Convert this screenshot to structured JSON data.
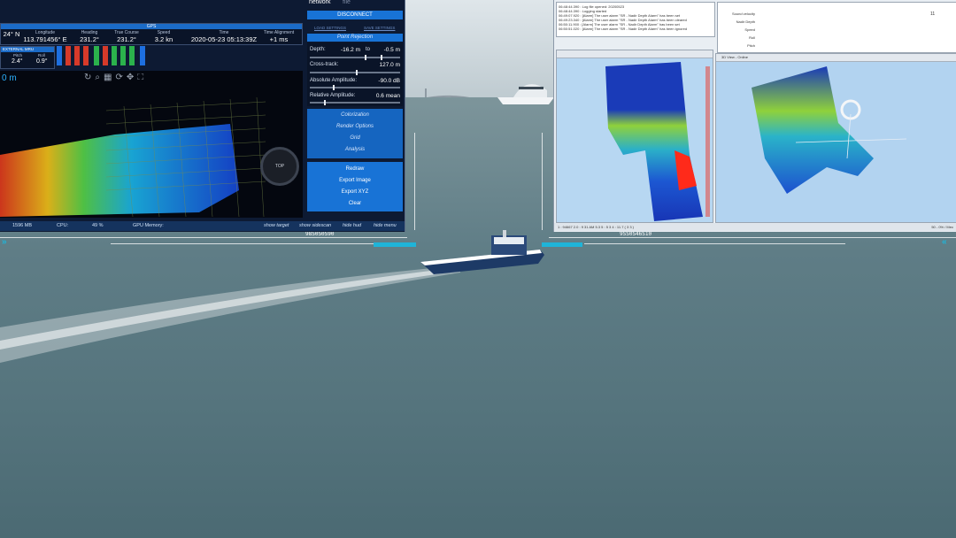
{
  "gps": {
    "title": "GPS",
    "fields": [
      {
        "label": "",
        "value": "24° N"
      },
      {
        "label": "Longitude",
        "value": "113.791456° E"
      },
      {
        "label": "Heading",
        "value": "231.2°"
      },
      {
        "label": "True Course",
        "value": "231.2°"
      },
      {
        "label": "Speed",
        "value": "3.2 kn"
      },
      {
        "label": "Time",
        "value": "2020-05-23 05:13:39Z"
      },
      {
        "label": "Time Alignment",
        "value": "+1 ms"
      }
    ]
  },
  "external_mru": {
    "title": "EXTERNAL MRU",
    "fields": [
      {
        "label": "Pitch",
        "value": "2.4°"
      },
      {
        "label": "Roll",
        "value": "0.9°"
      }
    ]
  },
  "viewport": {
    "label": "0 m",
    "compass_label": "TOP"
  },
  "side_panel": {
    "tab_network": "network",
    "tab_other": "file",
    "disconnect": "DISCONNECT",
    "load_settings": "LOAD SETTINGS",
    "save_settings": "SAVE SETTINGS",
    "point_rejection": "Point Rejection",
    "depth": {
      "label": "Depth:",
      "from": "-16.2 m",
      "to_word": "to",
      "to": "-0.5 m"
    },
    "cross_track": {
      "label": "Cross-track:",
      "value": "127.0 m"
    },
    "absolute_amplitude": {
      "label": "Absolute Amplitude:",
      "value": "-90.0 dB"
    },
    "relative_amplitude": {
      "label": "Relative Amplitude:",
      "value": "0.6 mean"
    },
    "menu": [
      "Colorization",
      "Render Options",
      "Grid",
      "Analysis"
    ],
    "actions": [
      "Redraw",
      "Export Image",
      "Export XYZ",
      "Clear"
    ]
  },
  "status_left": {
    "memory": "1596 MB",
    "cpu_label": "CPU:",
    "cpu_value": "49 %",
    "gpu_label": "GPU Memory:",
    "buttons": [
      "show target",
      "show sidescan",
      "hide hud",
      "hide menu"
    ]
  },
  "log": {
    "lines": [
      "06:48:44.390 : Log file opened: 20200523",
      "06:48:44.390 : Logging started",
      "06:49:07.920 : [Alarm] The user alarm \"SR - Nadir Depth Alarm\" has been set",
      "06:49:23.340 : [Alarm] The user alarm \"SR - Nadir Depth Alarm\" has been cleared",
      "06:50:11.900 : [Alarm] The user alarm \"SR - Nadir Depth Alarm\" has been set",
      "06:50:51.020 : [Alarm] The user alarm \"SR - Nadir Depth Alarm\" has been ignored"
    ]
  },
  "props": {
    "labels": [
      "Sound velocity",
      "Nadir Depth",
      "Speed",
      "Roll",
      "Pitch"
    ],
    "value": "11"
  },
  "plot2": {
    "title": "3D View - Online"
  },
  "status_right": {
    "text": "1 : 94667 2.0 : 9 31 AM 5.3 5 : 5 3 4 : 11.7 ( 3 3 )",
    "right": "50 - 0% / Mec"
  },
  "hud": {
    "left_code": "98S0S0S90",
    "right_code": "9SS0S46S10"
  },
  "colors": {
    "panel_blue": "#1873d6",
    "hud_cyan": "#1fb4d8",
    "dark_bg": "#0d1a33"
  }
}
